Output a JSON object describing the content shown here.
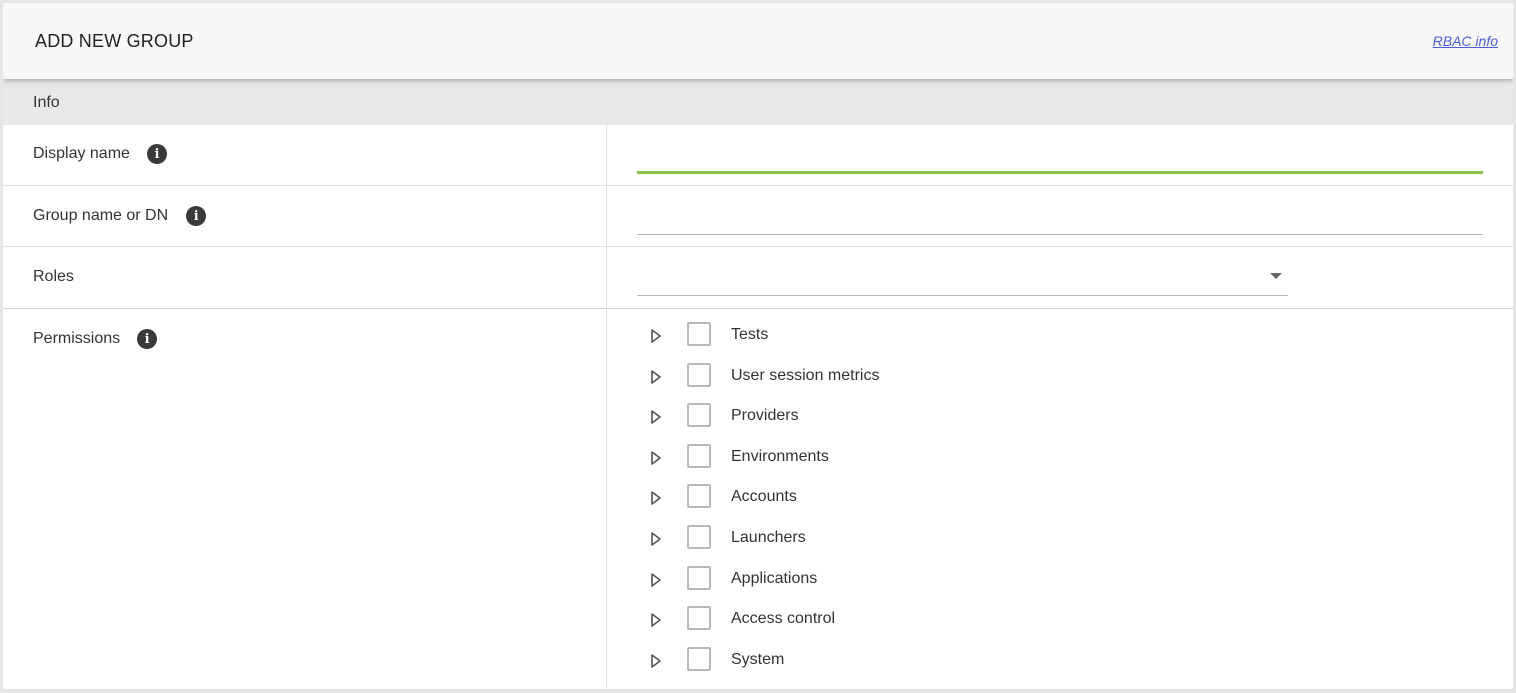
{
  "header": {
    "title": "ADD NEW GROUP",
    "rbac_link": "RBAC info"
  },
  "section": {
    "label": "Info"
  },
  "fields": {
    "display_name": {
      "label": "Display name",
      "value": "",
      "icon": "info-icon"
    },
    "group_name": {
      "label": "Group name or DN",
      "value": "",
      "icon": "info-icon"
    },
    "roles": {
      "label": "Roles",
      "selected": "",
      "icon": "chevron-down-icon"
    },
    "permissions": {
      "label": "Permissions",
      "icon": "info-icon"
    }
  },
  "permissions_tree": [
    {
      "label": "Tests",
      "checked": false
    },
    {
      "label": "User session metrics",
      "checked": false
    },
    {
      "label": "Providers",
      "checked": false
    },
    {
      "label": "Environments",
      "checked": false
    },
    {
      "label": "Accounts",
      "checked": false
    },
    {
      "label": "Launchers",
      "checked": false
    },
    {
      "label": "Applications",
      "checked": false
    },
    {
      "label": "Access control",
      "checked": false
    },
    {
      "label": "System",
      "checked": false
    }
  ],
  "colors": {
    "accent_active_underline": "#8bc34a",
    "link": "#4b5fd0",
    "header_bg": "#f7f7f7",
    "section_bg": "#e8e8e8",
    "info_icon_bg": "#3a3a3a"
  }
}
